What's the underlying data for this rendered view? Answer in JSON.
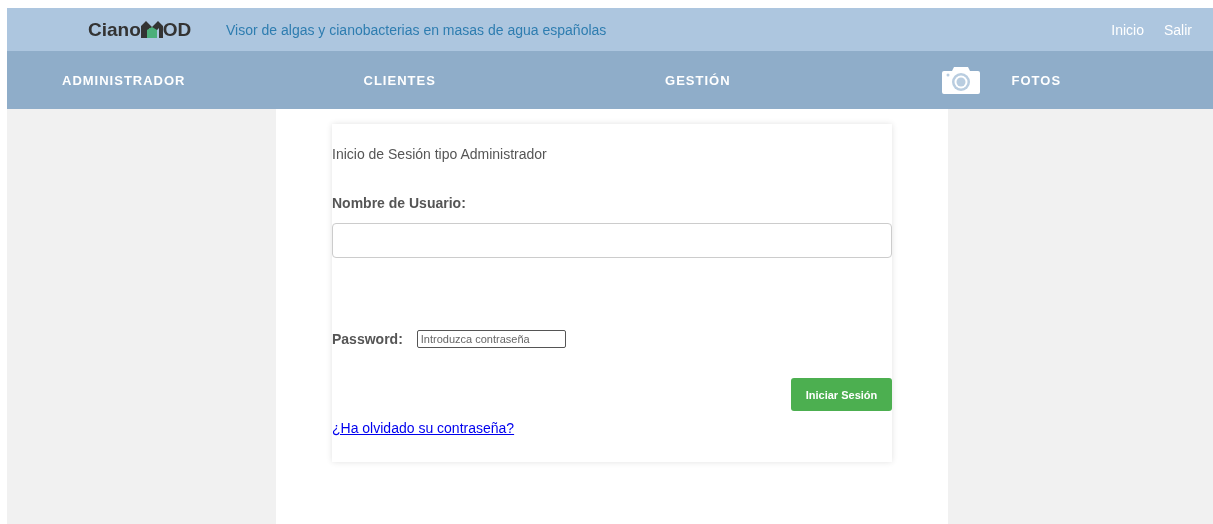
{
  "header": {
    "logo": {
      "before": "Ciano",
      "after": "OD"
    },
    "tagline": "Visor de algas y cianobacterias en masas de agua españolas",
    "links": [
      "Inicio",
      "Salir"
    ]
  },
  "nav": [
    {
      "label": "ADMINISTRADOR",
      "kind": "text"
    },
    {
      "label": "CLIENTES",
      "kind": "text"
    },
    {
      "label": "GESTIÓN",
      "kind": "text"
    },
    {
      "label": "FOTOS",
      "kind": "photo"
    }
  ],
  "login": {
    "title": "Inicio de Sesión tipo Administrador",
    "username_label": "Nombre de Usuario:",
    "password_label": "Password:",
    "password_placeholder": "Introduzca contraseña",
    "submit": "Iniciar Sesión",
    "forgot_link": "¿Ha olvidado su contraseña?"
  }
}
